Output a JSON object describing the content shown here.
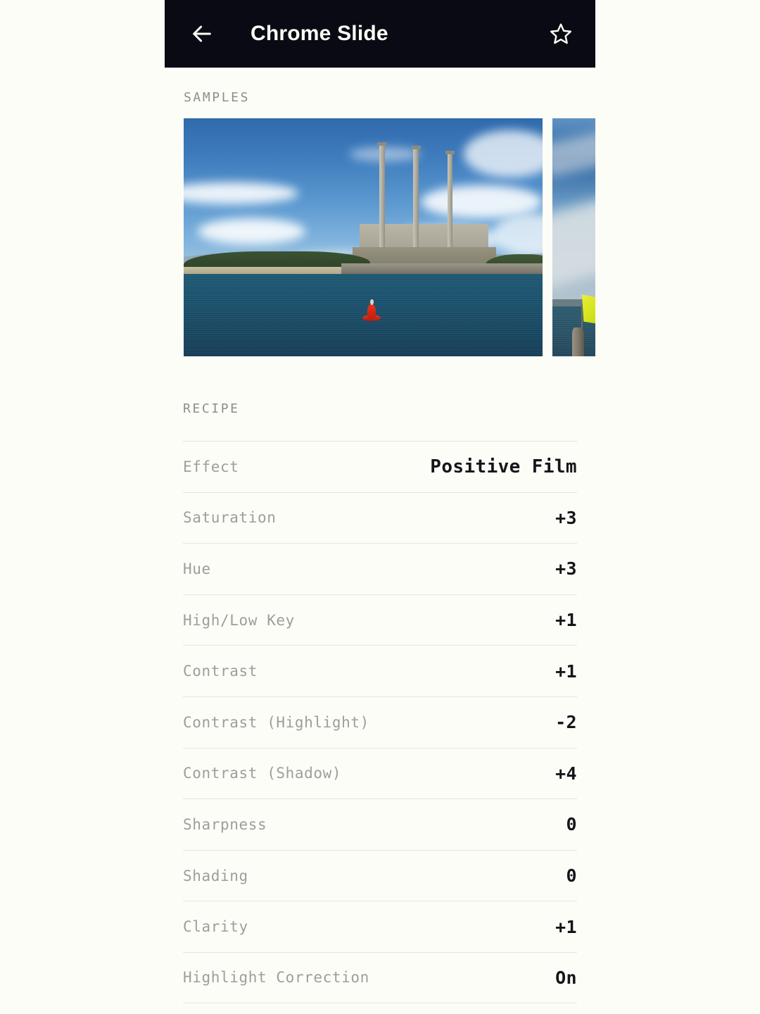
{
  "appbar": {
    "back_icon": "arrow-left-icon",
    "title": "Chrome Slide",
    "favorite_icon": "star-outline-icon"
  },
  "sections": {
    "samples_label": "SAMPLES",
    "recipe_label": "RECIPE"
  },
  "samples": [
    {
      "alt": "Power plant with three smokestacks across bay water with red buoy",
      "subject": "morro-bay-power-plant"
    },
    {
      "alt": "Yellow flag on pole beside water under cloudy blue sky",
      "subject": "yellow-flag-harbor"
    }
  ],
  "recipe": [
    {
      "key": "Effect",
      "value": "Positive Film"
    },
    {
      "key": "Saturation",
      "value": "+3"
    },
    {
      "key": "Hue",
      "value": "+3"
    },
    {
      "key": "High/Low Key",
      "value": "+1"
    },
    {
      "key": "Contrast",
      "value": "+1"
    },
    {
      "key": "Contrast (Highlight)",
      "value": "-2"
    },
    {
      "key": "Contrast (Shadow)",
      "value": "+4"
    },
    {
      "key": "Sharpness",
      "value": "0"
    },
    {
      "key": "Shading",
      "value": "0"
    },
    {
      "key": "Clarity",
      "value": "+1"
    },
    {
      "key": "Highlight Correction",
      "value": "On"
    }
  ],
  "colors": {
    "appbar_bg": "#0a0a14",
    "page_bg": "#fdfdf7",
    "label_gray": "#9d9d9d",
    "value_dark": "#15151a",
    "divider": "#e6e5de"
  }
}
